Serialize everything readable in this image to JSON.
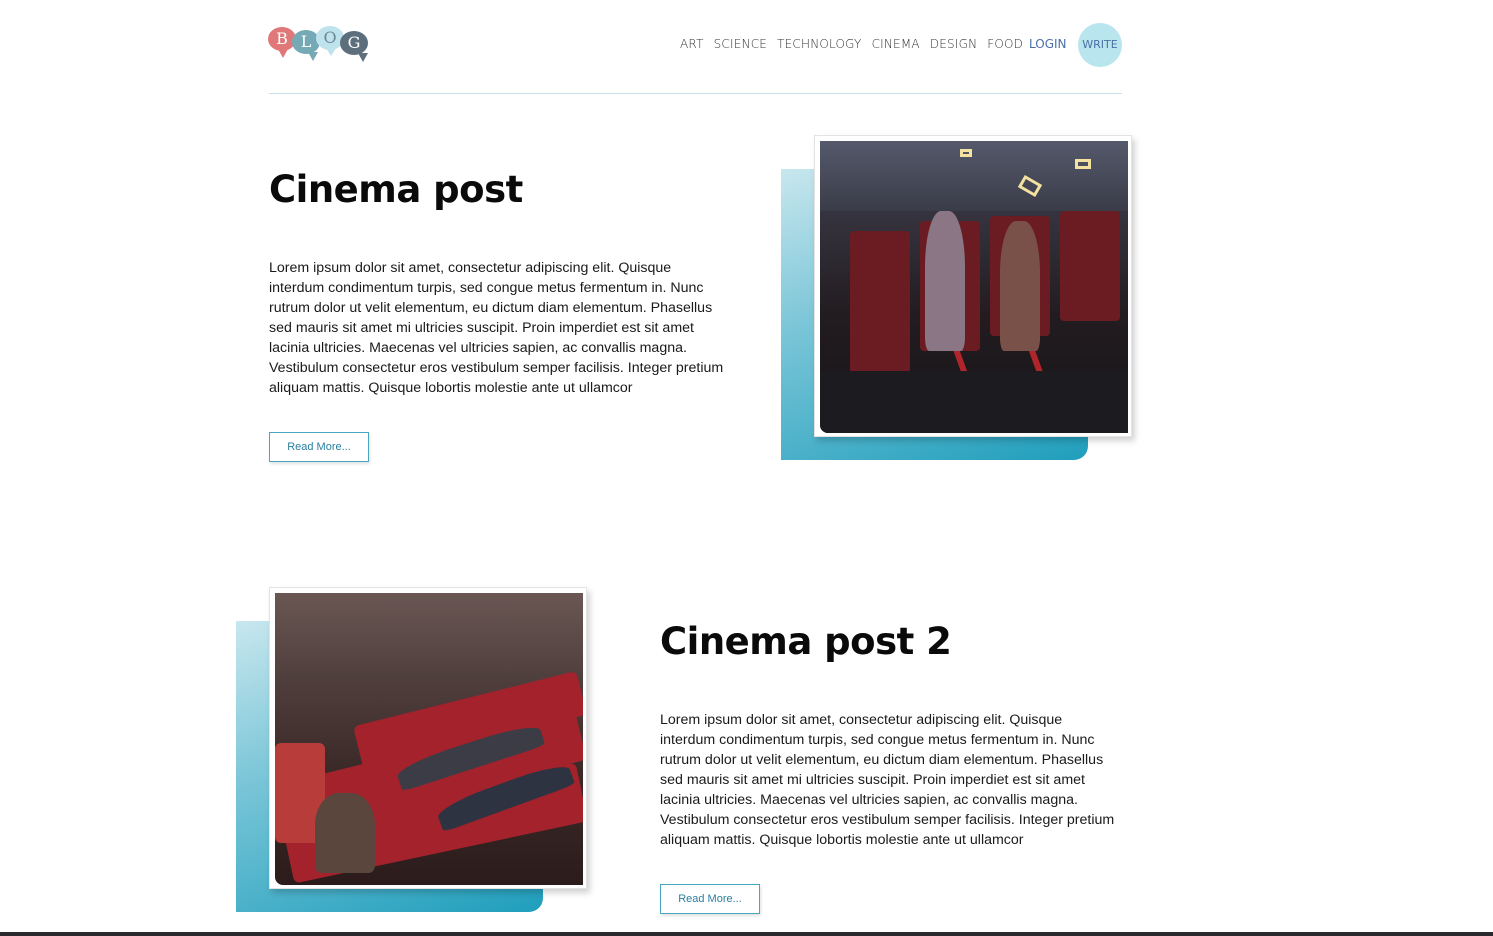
{
  "header": {
    "logo_letters": [
      "B",
      "L",
      "O",
      "G"
    ],
    "nav": [
      "ART",
      "SCIENCE",
      "TECHNOLOGY",
      "CINEMA",
      "DESIGN",
      "FOOD"
    ],
    "login": "LOGIN",
    "write": "WRITE"
  },
  "posts": [
    {
      "title": "Cinema post",
      "body": "Lorem ipsum dolor sit amet, consectetur adipiscing elit. Quisque interdum condimentum turpis, sed congue metus fermentum in. Nunc rutrum dolor ut velit elementum, eu dictum diam elementum. Phasellus sed mauris sit amet mi ultricies suscipit. Proin imperdiet est sit amet lacinia ultricies. Maecenas vel ultricies sapien, ac convallis magna. Vestibulum consectetur eros vestibulum semper facilisis. Integer pretium aliquam mattis. Quisque lobortis molestie ante ut ullamcor",
      "read_more": "Read More..."
    },
    {
      "title": "Cinema post 2",
      "body": "Lorem ipsum dolor sit amet, consectetur adipiscing elit. Quisque interdum condimentum turpis, sed congue metus fermentum in. Nunc rutrum dolor ut velit elementum, eu dictum diam elementum. Phasellus sed mauris sit amet mi ultricies suscipit. Proin imperdiet est sit amet lacinia ultricies. Maecenas vel ultricies sapien, ac convallis magna. Vestibulum consectetur eros vestibulum semper facilisis. Integer pretium aliquam mattis. Quisque lobortis molestie ante ut ullamcor",
      "read_more": "Read More..."
    }
  ],
  "colors": {
    "accent_gradient_start": "#c8e7ee",
    "accent_gradient_end": "#1f9ebc",
    "write_bg": "#b9e6ee",
    "link": "#4a6fa5"
  }
}
